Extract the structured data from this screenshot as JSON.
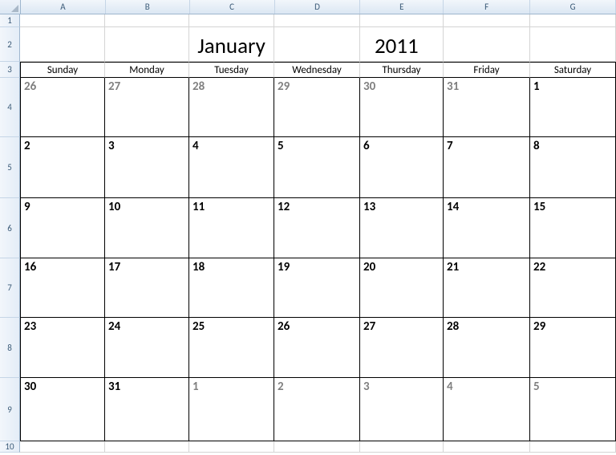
{
  "columns": [
    "A",
    "B",
    "C",
    "D",
    "E",
    "F",
    "G"
  ],
  "row_numbers": [
    1,
    2,
    3,
    4,
    5,
    6,
    7,
    8,
    9,
    10
  ],
  "title": {
    "month": "January",
    "year": "2011"
  },
  "days_of_week": [
    "Sunday",
    "Monday",
    "Tuesday",
    "Wednesday",
    "Thursday",
    "Friday",
    "Saturday"
  ],
  "calendar": [
    [
      {
        "n": "26",
        "other": true
      },
      {
        "n": "27",
        "other": true
      },
      {
        "n": "28",
        "other": true
      },
      {
        "n": "29",
        "other": true
      },
      {
        "n": "30",
        "other": true
      },
      {
        "n": "31",
        "other": true
      },
      {
        "n": "1",
        "other": false
      }
    ],
    [
      {
        "n": "2",
        "other": false
      },
      {
        "n": "3",
        "other": false
      },
      {
        "n": "4",
        "other": false
      },
      {
        "n": "5",
        "other": false
      },
      {
        "n": "6",
        "other": false
      },
      {
        "n": "7",
        "other": false
      },
      {
        "n": "8",
        "other": false
      }
    ],
    [
      {
        "n": "9",
        "other": false
      },
      {
        "n": "10",
        "other": false
      },
      {
        "n": "11",
        "other": false
      },
      {
        "n": "12",
        "other": false
      },
      {
        "n": "13",
        "other": false
      },
      {
        "n": "14",
        "other": false
      },
      {
        "n": "15",
        "other": false
      }
    ],
    [
      {
        "n": "16",
        "other": false
      },
      {
        "n": "17",
        "other": false
      },
      {
        "n": "18",
        "other": false
      },
      {
        "n": "19",
        "other": false
      },
      {
        "n": "20",
        "other": false
      },
      {
        "n": "21",
        "other": false
      },
      {
        "n": "22",
        "other": false
      }
    ],
    [
      {
        "n": "23",
        "other": false
      },
      {
        "n": "24",
        "other": false
      },
      {
        "n": "25",
        "other": false
      },
      {
        "n": "26",
        "other": false
      },
      {
        "n": "27",
        "other": false
      },
      {
        "n": "28",
        "other": false
      },
      {
        "n": "29",
        "other": false
      }
    ],
    [
      {
        "n": "30",
        "other": false
      },
      {
        "n": "31",
        "other": false
      },
      {
        "n": "1",
        "other": true
      },
      {
        "n": "2",
        "other": true
      },
      {
        "n": "3",
        "other": true
      },
      {
        "n": "4",
        "other": true
      },
      {
        "n": "5",
        "other": true
      }
    ]
  ],
  "row_heights": {
    "r1": 16,
    "r2": 43,
    "r3": 20,
    "r4": 74,
    "r5": 76,
    "r6": 75,
    "r7": 74,
    "r8": 75,
    "r9": 79,
    "r10": 14
  }
}
